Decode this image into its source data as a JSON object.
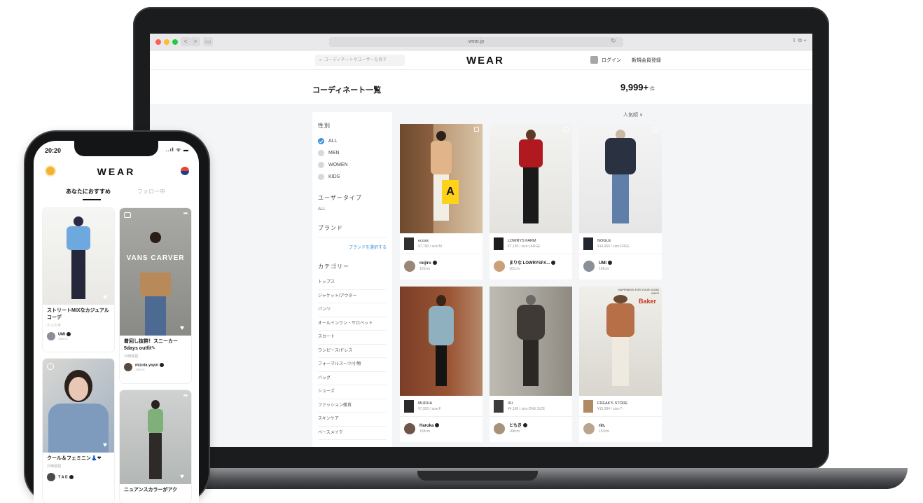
{
  "browser": {
    "url": "wear.jp",
    "nav_back": "<",
    "nav_forward": ">",
    "sidebar_toggle": "▭",
    "reload": "↻",
    "share_tabs": "⇪ ⧉ +"
  },
  "site_header": {
    "search_placeholder": "コーディネートやユーザーを探す",
    "logo": "WEAR",
    "login": "ログイン",
    "signup": "新規会員登録"
  },
  "page": {
    "title": "コーディネート一覧",
    "count": "9,999+",
    "count_unit": "件",
    "sort": "人気順 ∨"
  },
  "filters": {
    "gender_heading": "性別",
    "gender_options": [
      "ALL",
      "MEN",
      "WOMEN",
      "KIDS"
    ],
    "gender_selected": "ALL",
    "user_type_heading": "ユーザータイプ",
    "user_type_value": "ALL",
    "brand_heading": "ブランド",
    "brand_link": "ブランドを選択する",
    "category_heading": "カテゴリー",
    "categories": [
      "トップス",
      "ジャケット/アウター",
      "パンツ",
      "オールインワン・サロペット",
      "スカート",
      "ワンピース/ドレス",
      "フォーマルスーツ/小物",
      "バッグ",
      "シューズ",
      "ファッション雑貨",
      "スキンケア",
      "ベースメイク"
    ]
  },
  "coordinates": [
    {
      "brand": "ecosic",
      "price": "¥7,700 / size:M",
      "user": "reijiro",
      "height": "165cm"
    },
    {
      "brand": "LOWRYS FARM",
      "price": "¥7,150 / size:LARGE",
      "user": "まりな LOWRYSFA...",
      "height": "161cm"
    },
    {
      "brand": "NOGLE",
      "price": "¥14,960 / size:FREE",
      "user": "UMI",
      "height": "166cm"
    },
    {
      "brand": "MURUA",
      "price": "¥7,920 / size:F",
      "user": "Haruka",
      "height": "158cm"
    },
    {
      "brand": "XU",
      "price": "¥4,180 / size:ONE SIZE",
      "user": "ともき",
      "height": "168cm"
    },
    {
      "brand": "FREAK'S STORE",
      "price": "¥15,994 / size:7-",
      "user": "rin.",
      "height": "153cm"
    }
  ],
  "photo_text": {
    "sign_a": "A",
    "store_sign": "HAPPINESS FOR YOUR GOOD DAYS",
    "store_logo": "Baker"
  },
  "phone": {
    "time": "20:20",
    "status": "..ıl ᯤ ▬",
    "logo": "WEAR",
    "tab_recommended": "あなたにおすすめ",
    "tab_following": "フォロー中",
    "feed": [
      {
        "title": "ストリートMIXなカジュアルコーデ",
        "sub": "たった今",
        "user": "UMI",
        "user_sub": "166cm"
      },
      {
        "photo_text": "VANS CARVER",
        "title": "着回し抜群！スニーカー5days outfit✎",
        "sub": "16時間前",
        "user": "mizota yayoi",
        "user_sub": "158cm"
      },
      {
        "title": "クール＆フェミニン👗❤",
        "sub": "22時間前",
        "user": "T A E",
        "user_sub": ""
      },
      {
        "title": "ニュアンスカラーがアク",
        "sub": "",
        "user": "",
        "user_sub": ""
      }
    ]
  },
  "colors": {
    "accent_blue": "#3d8fd9",
    "laptop_frame": "#1b1c1e",
    "page_bg": "#f4f5f6"
  }
}
